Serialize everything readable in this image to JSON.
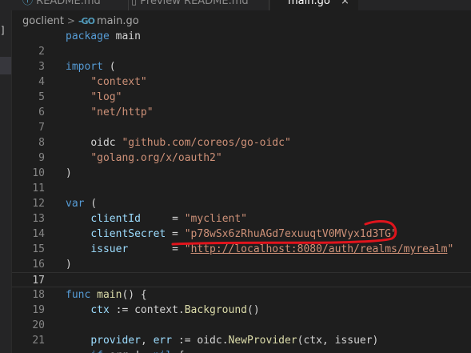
{
  "tabs": [
    {
      "label": "README.md"
    },
    {
      "label": "Preview README.md"
    },
    {
      "label": "main.go",
      "close": "×"
    }
  ],
  "breadcrumb": {
    "folder": "goclient",
    "go_icon": "-GO",
    "file": "main.go"
  },
  "sidebar_sliver": {
    "bracket": "]"
  },
  "colors": {
    "keyword": "#569cd6",
    "string": "#ce9178",
    "identifier": "#9cdcfe",
    "function": "#dcdcaa",
    "annotation": "#e0141c"
  },
  "code_lines": [
    {
      "num": "",
      "tokens": [
        {
          "t": "package",
          "c": "kw"
        },
        {
          "t": " main",
          "c": "tx"
        }
      ]
    },
    {
      "num": "2",
      "tokens": []
    },
    {
      "num": "3",
      "tokens": [
        {
          "t": "import",
          "c": "kw"
        },
        {
          "t": " (",
          "c": "tx"
        }
      ]
    },
    {
      "num": "4",
      "tokens": [
        {
          "t": "    ",
          "c": "tx"
        },
        {
          "t": "\"context\"",
          "c": "str"
        }
      ]
    },
    {
      "num": "5",
      "tokens": [
        {
          "t": "    ",
          "c": "tx"
        },
        {
          "t": "\"log\"",
          "c": "str"
        }
      ]
    },
    {
      "num": "6",
      "tokens": [
        {
          "t": "    ",
          "c": "tx"
        },
        {
          "t": "\"net/http\"",
          "c": "str"
        }
      ]
    },
    {
      "num": "7",
      "tokens": []
    },
    {
      "num": "8",
      "tokens": [
        {
          "t": "    ",
          "c": "tx"
        },
        {
          "t": "oidc ",
          "c": "tx"
        },
        {
          "t": "\"github.com/coreos/go-oidc\"",
          "c": "str"
        }
      ]
    },
    {
      "num": "9",
      "tokens": [
        {
          "t": "    ",
          "c": "tx"
        },
        {
          "t": "\"golang.org/x/oauth2\"",
          "c": "str"
        }
      ]
    },
    {
      "num": "10",
      "tokens": [
        {
          "t": ")",
          "c": "tx"
        }
      ]
    },
    {
      "num": "11",
      "tokens": []
    },
    {
      "num": "12",
      "tokens": [
        {
          "t": "var",
          "c": "kw"
        },
        {
          "t": " (",
          "c": "tx"
        }
      ]
    },
    {
      "num": "13",
      "tokens": [
        {
          "t": "    ",
          "c": "tx"
        },
        {
          "t": "clientId",
          "c": "id"
        },
        {
          "t": "     = ",
          "c": "tx"
        },
        {
          "t": "\"myclient\"",
          "c": "str"
        }
      ]
    },
    {
      "num": "14",
      "tokens": [
        {
          "t": "    ",
          "c": "tx"
        },
        {
          "t": "clientSecret",
          "c": "id"
        },
        {
          "t": " = ",
          "c": "tx"
        },
        {
          "t": "\"p78wSx6zRhuAGd7exuuqtV0MVyx1d3TG\"",
          "c": "str"
        }
      ]
    },
    {
      "num": "15",
      "tokens": [
        {
          "t": "    ",
          "c": "tx"
        },
        {
          "t": "issuer",
          "c": "id"
        },
        {
          "t": "       = ",
          "c": "tx"
        },
        {
          "t": "\"",
          "c": "str"
        },
        {
          "t": "http://localhost:8080/auth/realms/myrealm",
          "c": "str under"
        },
        {
          "t": "\"",
          "c": "str"
        }
      ]
    },
    {
      "num": "16",
      "tokens": [
        {
          "t": ")",
          "c": "tx"
        }
      ]
    },
    {
      "num": "17",
      "tokens": [],
      "current": true
    },
    {
      "num": "18",
      "tokens": [
        {
          "t": "func",
          "c": "kw"
        },
        {
          "t": " ",
          "c": "tx"
        },
        {
          "t": "main",
          "c": "fn"
        },
        {
          "t": "() {",
          "c": "tx"
        }
      ]
    },
    {
      "num": "19",
      "tokens": [
        {
          "t": "    ",
          "c": "tx"
        },
        {
          "t": "ctx",
          "c": "id"
        },
        {
          "t": " := context.",
          "c": "tx"
        },
        {
          "t": "Background",
          "c": "fn"
        },
        {
          "t": "()",
          "c": "tx"
        }
      ]
    },
    {
      "num": "20",
      "tokens": []
    },
    {
      "num": "21",
      "tokens": [
        {
          "t": "    ",
          "c": "tx"
        },
        {
          "t": "provider",
          "c": "id"
        },
        {
          "t": ", ",
          "c": "tx"
        },
        {
          "t": "err",
          "c": "id"
        },
        {
          "t": " := oidc.",
          "c": "tx"
        },
        {
          "t": "NewProvider",
          "c": "fn"
        },
        {
          "t": "(ctx, issuer)",
          "c": "tx"
        }
      ]
    },
    {
      "num": "",
      "tokens": [
        {
          "t": "    ",
          "c": "tx"
        },
        {
          "t": "if",
          "c": "kw"
        },
        {
          "t": " err != ",
          "c": "tx"
        },
        {
          "t": "nil",
          "c": "kw"
        },
        {
          "t": " {",
          "c": "tx"
        }
      ]
    }
  ]
}
